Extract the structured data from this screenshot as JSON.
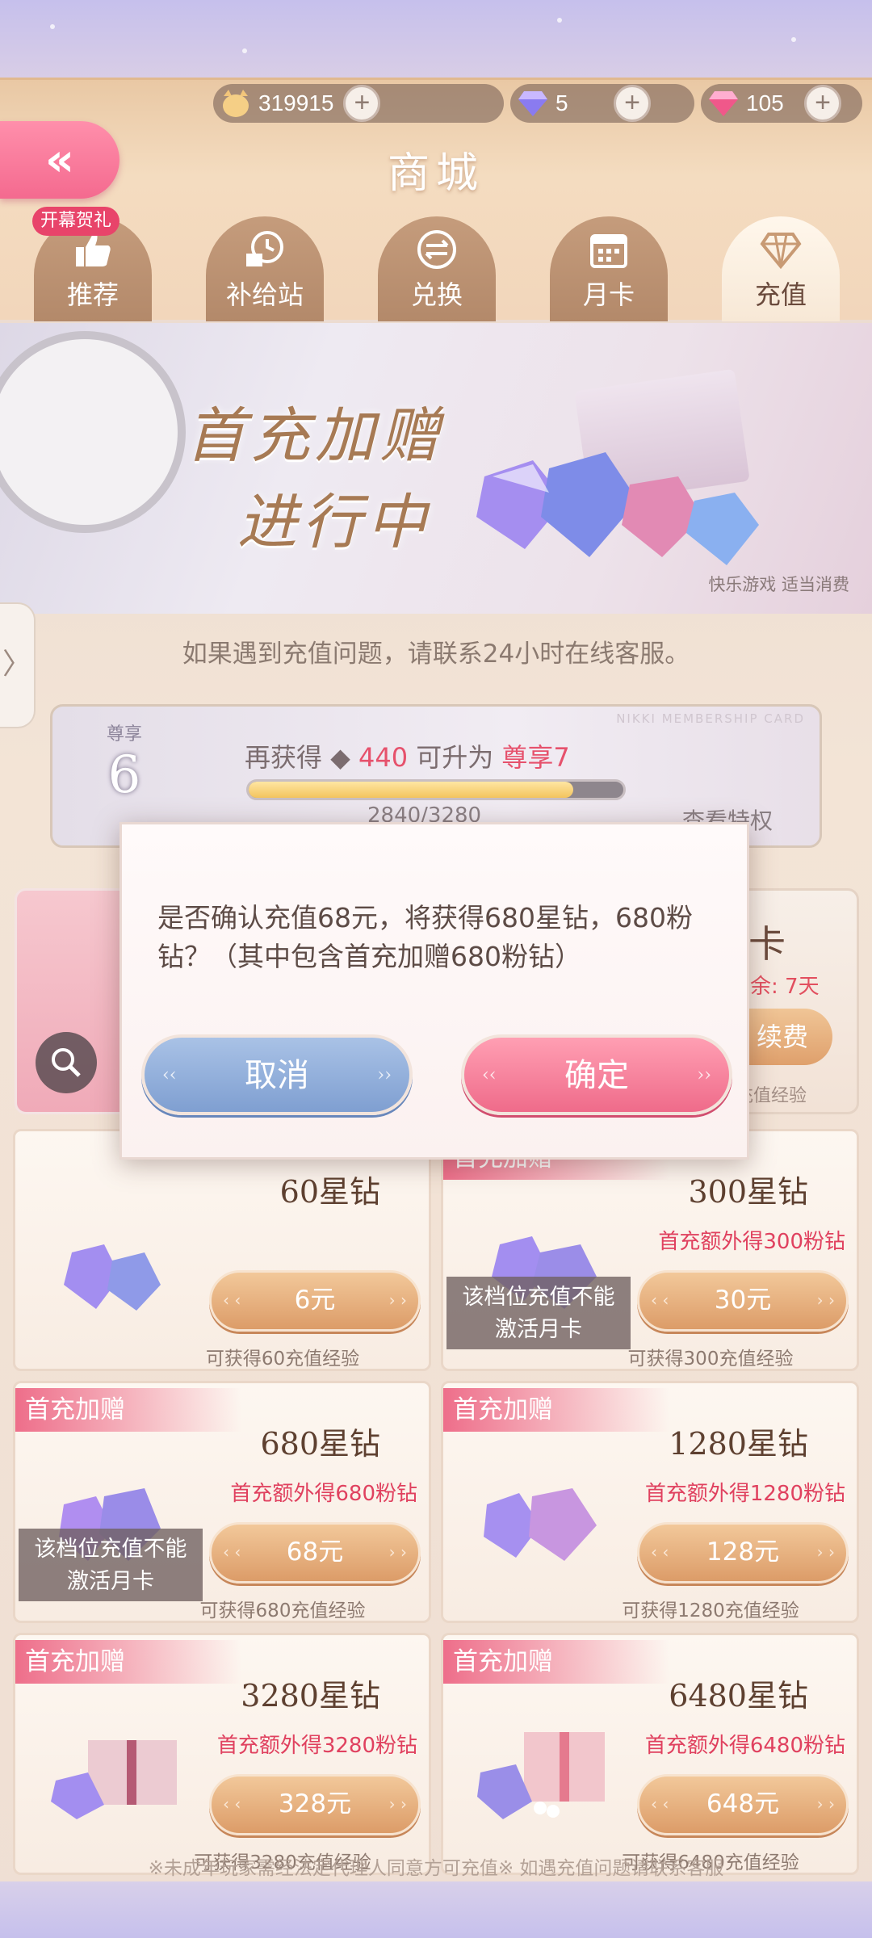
{
  "currency": {
    "coins": "319915",
    "star_gems": "5",
    "pink_gems": "105",
    "plus": "+"
  },
  "header": {
    "title": "商城",
    "back_icon": "double-chevron-left-icon",
    "badge": "开幕贺礼"
  },
  "tabs": [
    {
      "label": "推荐",
      "icon": "thumbs-up-icon"
    },
    {
      "label": "补给站",
      "icon": "gift-clock-icon"
    },
    {
      "label": "兑换",
      "icon": "exchange-icon"
    },
    {
      "label": "月卡",
      "icon": "calendar-icon"
    },
    {
      "label": "充值",
      "icon": "diamond-icon",
      "active": true
    }
  ],
  "banner": {
    "title_line1": "首充加赠",
    "title_line2": "进行中",
    "note": "快乐游戏 适当消费"
  },
  "notice": "如果遇到充值问题，请联系24小时在线客服。",
  "membership": {
    "level_label": "尊享",
    "level": "6",
    "text_prefix": "再获得",
    "needed": "440",
    "text_mid": "可升为",
    "next_level": "尊享7",
    "progress_current": 2840,
    "progress_max": 3280,
    "progress_text": "2840/3280",
    "view": "查看特权",
    "watermark": "NIKKI MEMBERSHIP CARD"
  },
  "side_tab": "〉",
  "monthly_card": {
    "title": "卡",
    "remaining": "余: 7天",
    "renew": "续费",
    "exp": "充值经验"
  },
  "products": [
    {
      "amount": "60星钻",
      "bonus": "",
      "price": "6元",
      "exp": "可获得60充值经验",
      "first": false,
      "warn": false
    },
    {
      "amount": "300星钻",
      "bonus": "首充额外得300粉钻",
      "price": "30元",
      "exp": "可获得300充值经验",
      "first": true,
      "warn": true
    },
    {
      "amount": "680星钻",
      "bonus": "首充额外得680粉钻",
      "price": "68元",
      "exp": "可获得680充值经验",
      "first": true,
      "warn": true
    },
    {
      "amount": "1280星钻",
      "bonus": "首充额外得1280粉钻",
      "price": "128元",
      "exp": "可获得1280充值经验",
      "first": true,
      "warn": false
    },
    {
      "amount": "3280星钻",
      "bonus": "首充额外得3280粉钻",
      "price": "328元",
      "exp": "可获得3280充值经验",
      "first": true,
      "warn": false
    },
    {
      "amount": "6480星钻",
      "bonus": "首充额外得6480粉钻",
      "price": "648元",
      "exp": "可获得6480充值经验",
      "first": true,
      "warn": false
    }
  ],
  "first_tag": "首充加赠",
  "warn_text_1": "该档位充值不能",
  "warn_text_2": "激活月卡",
  "footer_note": "※未成年玩家需经法定代理人同意方可充值※ 如遇充值问题请联系客服",
  "dialog": {
    "message": "是否确认充值68元，将获得680星钻，680粉钻？（其中包含首充加赠680粉钻）",
    "cancel": "取消",
    "confirm": "确定"
  },
  "colors": {
    "accent_pink": "#ef6b8a",
    "accent_blue": "#7f9fd1",
    "gold_button": "#dc9c68",
    "bonus_red": "#e0415f"
  }
}
